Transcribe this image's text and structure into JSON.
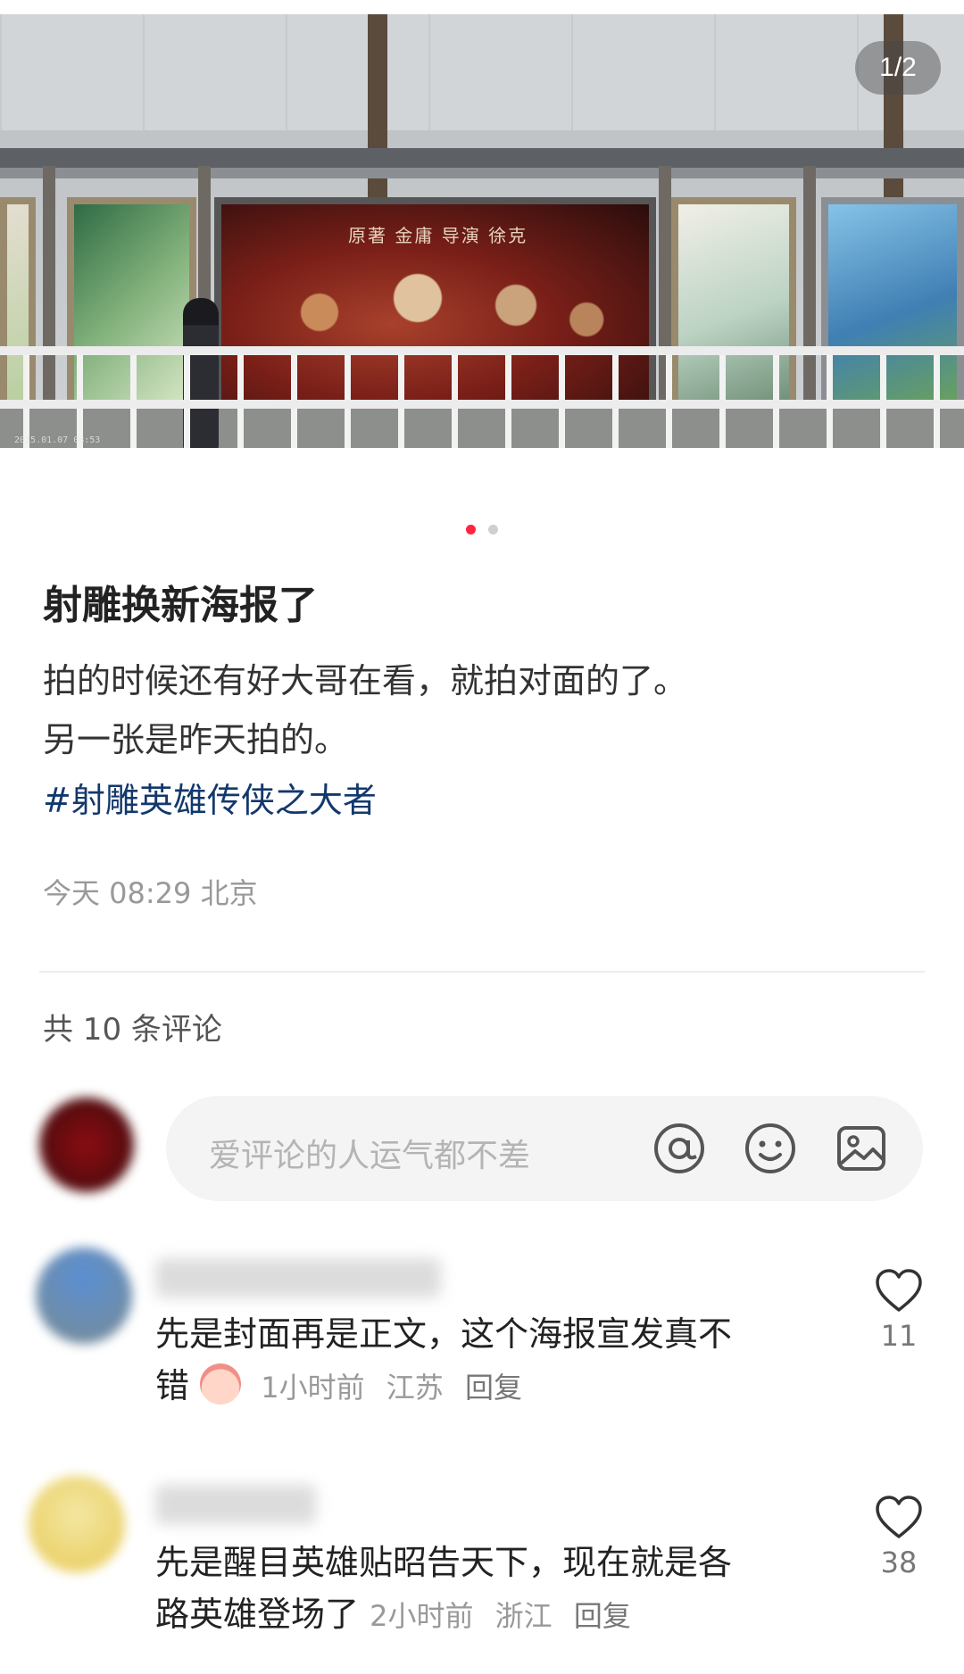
{
  "gallery": {
    "counter": "1/2",
    "poster_text": "原著 金庸 导演 徐克",
    "photo_stamp": "2025.01.07 08:53",
    "active_index": 1,
    "total": 2
  },
  "post": {
    "title": "射雕换新海报了",
    "body_line1": "拍的时候还有好大哥在看，就拍对面的了。",
    "body_line2": "另一张是昨天拍的。",
    "hashtag": "#射雕英雄传侠之大者",
    "meta": "今天 08:29 北京"
  },
  "comments_header": {
    "count_label": "共 10 条评论"
  },
  "comment_input": {
    "placeholder": "爱评论的人运气都不差",
    "icons": [
      "at-icon",
      "emoji-icon",
      "image-icon"
    ]
  },
  "comments": [
    {
      "text_line1": "先是封面再是正文，这个海报宣发真不",
      "text_line2": "错",
      "time": "1小时前",
      "location": "江苏",
      "reply": "回复",
      "likes": "11"
    },
    {
      "text_line1": "先是醒目英雄贴昭告天下，现在就是各",
      "text_line2": "路英雄登场了",
      "time": "2小时前",
      "location": "浙江",
      "reply": "回复",
      "likes": "38"
    }
  ],
  "colors": {
    "accent": "#ff2442",
    "hashtag": "#13386c",
    "muted": "#999999"
  }
}
